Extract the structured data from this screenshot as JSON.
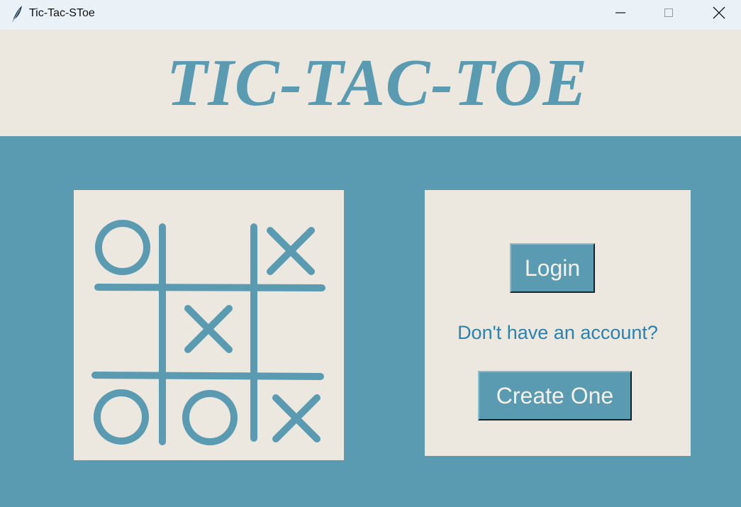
{
  "window": {
    "title": "Tic-Tac-SToe",
    "icon": "feather-icon",
    "controls": [
      "minimize-icon",
      "maximize-icon",
      "close-icon"
    ]
  },
  "header": {
    "title": "TIC-TAC-TOE"
  },
  "board": {
    "cells": [
      "O",
      "",
      "X",
      "",
      "X",
      "",
      "O",
      "O",
      "X"
    ]
  },
  "login_panel": {
    "login_label": "Login",
    "prompt": "Don't have an account?",
    "create_label": "Create One"
  },
  "colors": {
    "accent": "#5a9bb2",
    "panel": "#ece7df",
    "titlebar": "#eaf2f7",
    "prompt_text": "#2d82ad",
    "button_text": "#f4f1ea"
  }
}
